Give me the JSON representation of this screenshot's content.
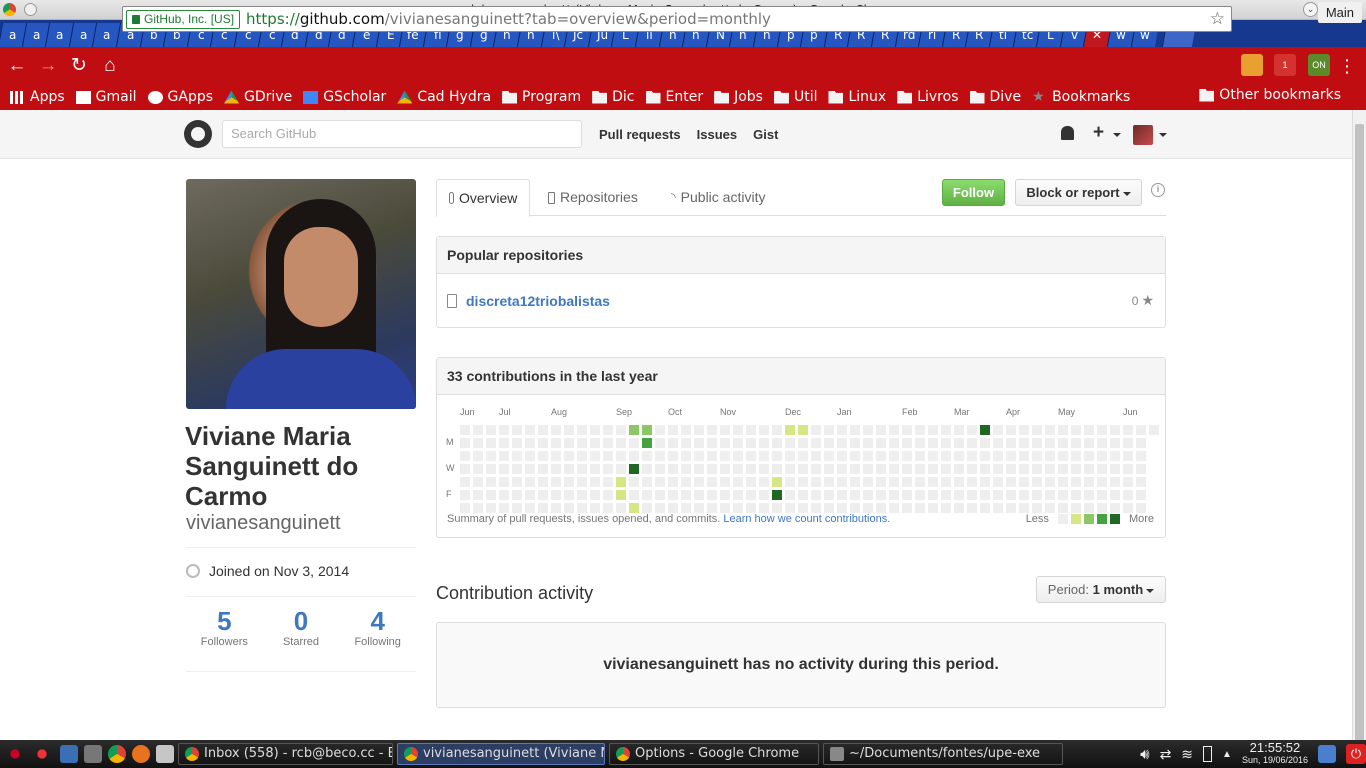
{
  "window": {
    "title": "vivianesanguinett (Viviane Maria Sanguinett do Carmo) - Google Chrome"
  },
  "tabs": [
    "a",
    "a",
    "a",
    "a",
    "a",
    "a",
    "b",
    "b",
    "c",
    "c",
    "c",
    "c",
    "d",
    "d",
    "d",
    "e",
    "E",
    "fe",
    "fl",
    "g",
    "g",
    "h",
    "h",
    "i\\",
    "Jc",
    "Ju",
    "L",
    "ll",
    "n",
    "n",
    "N",
    "n",
    "n",
    "p",
    "p",
    "R",
    "R",
    "R",
    "rd",
    "rl",
    "R",
    "R",
    "tl",
    "tc",
    "L",
    "v",
    "",
    "w",
    "w"
  ],
  "profile_button": "Main",
  "omnibox": {
    "ev_label": "GitHub, Inc. [US]",
    "scheme": "https://",
    "host": "github.com",
    "path": "/vivianesanguinett?tab=overview&period=monthly"
  },
  "bookmarks": {
    "items": [
      {
        "label": "Apps",
        "icon": "apps-icon"
      },
      {
        "label": "Gmail",
        "icon": "gmail-icon"
      },
      {
        "label": "GApps",
        "icon": "google-icon"
      },
      {
        "label": "GDrive",
        "icon": "drive-icon"
      },
      {
        "label": "GScholar",
        "icon": "scholar-icon"
      },
      {
        "label": "Cad Hydra",
        "icon": "drive-icon"
      },
      {
        "label": "Program",
        "icon": "folder-icon"
      },
      {
        "label": "Dic",
        "icon": "folder-icon"
      },
      {
        "label": "Enter",
        "icon": "folder-icon"
      },
      {
        "label": "Jobs",
        "icon": "folder-icon"
      },
      {
        "label": "Util",
        "icon": "folder-icon"
      },
      {
        "label": "Linux",
        "icon": "folder-icon"
      },
      {
        "label": "Livros",
        "icon": "folder-icon"
      },
      {
        "label": "Dive",
        "icon": "folder-icon"
      },
      {
        "label": "Bookmarks",
        "icon": "star-icon"
      }
    ],
    "other": "Other bookmarks"
  },
  "gh_header": {
    "search_placeholder": "Search GitHub",
    "nav": [
      "Pull requests",
      "Issues",
      "Gist"
    ]
  },
  "profile": {
    "fullname": "Viviane Maria Sanguinett do Carmo",
    "username": "vivianesanguinett",
    "joined": "Joined on Nov 3, 2014",
    "stats": [
      {
        "num": "5",
        "label": "Followers"
      },
      {
        "num": "0",
        "label": "Starred"
      },
      {
        "num": "4",
        "label": "Following"
      }
    ]
  },
  "profile_tabs": [
    "Overview",
    "Repositories",
    "Public activity"
  ],
  "actions": {
    "follow": "Follow",
    "block": "Block or report"
  },
  "popular": {
    "title": "Popular repositories",
    "repo": "discreta12triobalistas",
    "stars": "0"
  },
  "contributions": {
    "title": "33 contributions in the last year",
    "months": [
      "Jun",
      "Jul",
      "Aug",
      "Sep",
      "Oct",
      "Nov",
      "Dec",
      "Jan",
      "Feb",
      "Mar",
      "Apr",
      "May",
      "Jun"
    ],
    "days": [
      "M",
      "W",
      "F"
    ],
    "summary": "Summary of pull requests, issues opened, and commits.",
    "learn_link": "Learn how we count contributions.",
    "less": "Less",
    "more": "More",
    "colors": [
      "#eeeeee",
      "#d6e685",
      "#8cc665",
      "#44a340",
      "#1e6823"
    ],
    "active_cells": [
      {
        "week": 12,
        "day": 4,
        "level": 1
      },
      {
        "week": 12,
        "day": 5,
        "level": 1
      },
      {
        "week": 13,
        "day": 0,
        "level": 2
      },
      {
        "week": 13,
        "day": 3,
        "level": 4
      },
      {
        "week": 13,
        "day": 6,
        "level": 1
      },
      {
        "week": 14,
        "day": 0,
        "level": 2
      },
      {
        "week": 14,
        "day": 1,
        "level": 3
      },
      {
        "week": 24,
        "day": 4,
        "level": 1
      },
      {
        "week": 24,
        "day": 5,
        "level": 4
      },
      {
        "week": 25,
        "day": 0,
        "level": 1
      },
      {
        "week": 26,
        "day": 0,
        "level": 1
      },
      {
        "week": 40,
        "day": 0,
        "level": 4
      }
    ]
  },
  "activity": {
    "title": "Contribution activity",
    "period_label": "Period:",
    "period_value": "1 month",
    "empty": "vivianesanguinett has no activity during this period."
  },
  "taskbar": {
    "tasks": [
      {
        "label": "Inbox (558) - rcb@beco.cc - B",
        "active": false
      },
      {
        "label": "vivianesanguinett (Viviane Ma",
        "active": true
      },
      {
        "label": "Options - Google Chrome",
        "active": false
      },
      {
        "label": "~/Documents/fontes/upe-exe",
        "active": false
      }
    ],
    "time": "21:55:52",
    "date": "Sun, 19/06/2016"
  }
}
